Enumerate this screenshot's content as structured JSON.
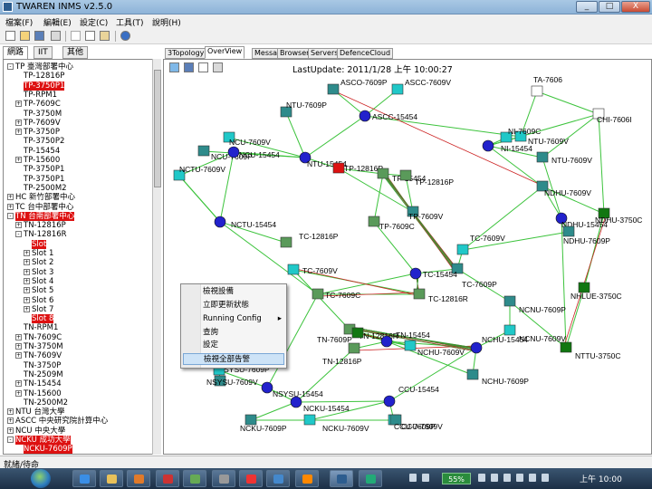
{
  "window": {
    "title": "TWAREN INMS v2.5.0",
    "min": "_",
    "max": "□",
    "close": "X"
  },
  "menu": [
    "檔案(F)",
    "編輯(E)",
    "設定(C)",
    "工具(T)",
    "說明(H)"
  ],
  "left_tabs": [
    "網路",
    "IIT",
    "其他"
  ],
  "tree": [
    {
      "label": "TP 臺灣部署中心",
      "depth": 0,
      "exp": "-",
      "hl": false
    },
    {
      "label": "TP-12816P",
      "depth": 1,
      "exp": "",
      "hl": false
    },
    {
      "label": "TP-3750P1",
      "depth": 1,
      "exp": "",
      "hl": true
    },
    {
      "label": "TP-RPM1",
      "depth": 1,
      "exp": "",
      "hl": false
    },
    {
      "label": "TP-7609C",
      "depth": 1,
      "exp": "+",
      "hl": false
    },
    {
      "label": "TP-3750M",
      "depth": 1,
      "exp": "",
      "hl": false
    },
    {
      "label": "TP-7609V",
      "depth": 1,
      "exp": "+",
      "hl": false
    },
    {
      "label": "TP-3750P",
      "depth": 1,
      "exp": "+",
      "hl": false
    },
    {
      "label": "TP-3750P2",
      "depth": 1,
      "exp": "",
      "hl": false
    },
    {
      "label": "TP-15454",
      "depth": 1,
      "exp": "",
      "hl": false
    },
    {
      "label": "TP-15600",
      "depth": 1,
      "exp": "+",
      "hl": false
    },
    {
      "label": "TP-3750P1",
      "depth": 1,
      "exp": "",
      "hl": false
    },
    {
      "label": "TP-3750P1",
      "depth": 1,
      "exp": "",
      "hl": false
    },
    {
      "label": "TP-2500M2",
      "depth": 1,
      "exp": "",
      "hl": false
    },
    {
      "label": "HC 新竹部署中心",
      "depth": 0,
      "exp": "+",
      "hl": false
    },
    {
      "label": "TC 台中部署中心",
      "depth": 0,
      "exp": "+",
      "hl": false
    },
    {
      "label": "TN 台南部署中心",
      "depth": 0,
      "exp": "-",
      "hl": true
    },
    {
      "label": "TN-12816P",
      "depth": 1,
      "exp": "+",
      "hl": false
    },
    {
      "label": "TN-12816R",
      "depth": 1,
      "exp": "-",
      "hl": false
    },
    {
      "label": "Slot",
      "depth": 2,
      "exp": "",
      "hl": true
    },
    {
      "label": "Slot 1",
      "depth": 2,
      "exp": "+",
      "hl": false
    },
    {
      "label": "Slot 2",
      "depth": 2,
      "exp": "+",
      "hl": false
    },
    {
      "label": "Slot 3",
      "depth": 2,
      "exp": "+",
      "hl": false
    },
    {
      "label": "Slot 4",
      "depth": 2,
      "exp": "+",
      "hl": false
    },
    {
      "label": "Slot 5",
      "depth": 2,
      "exp": "+",
      "hl": false
    },
    {
      "label": "Slot 6",
      "depth": 2,
      "exp": "+",
      "hl": false
    },
    {
      "label": "Slot 7",
      "depth": 2,
      "exp": "+",
      "hl": false
    },
    {
      "label": "Slot 8",
      "depth": 2,
      "exp": "",
      "hl": true
    },
    {
      "label": "TN-RPM1",
      "depth": 1,
      "exp": "",
      "hl": false
    },
    {
      "label": "TN-7609C",
      "depth": 1,
      "exp": "+",
      "hl": false
    },
    {
      "label": "TN-3750M",
      "depth": 1,
      "exp": "+",
      "hl": false
    },
    {
      "label": "TN-7609V",
      "depth": 1,
      "exp": "+",
      "hl": false
    },
    {
      "label": "TN-3750P",
      "depth": 1,
      "exp": "",
      "hl": false
    },
    {
      "label": "TN-2509M",
      "depth": 1,
      "exp": "",
      "hl": false
    },
    {
      "label": "TN-15454",
      "depth": 1,
      "exp": "+",
      "hl": false
    },
    {
      "label": "TN-15600",
      "depth": 1,
      "exp": "+",
      "hl": false
    },
    {
      "label": "TN-2500M2",
      "depth": 1,
      "exp": "",
      "hl": false
    },
    {
      "label": "NTU 台灣大學",
      "depth": 0,
      "exp": "+",
      "hl": false
    },
    {
      "label": "ASCC 中央研究院計算中心",
      "depth": 0,
      "exp": "+",
      "hl": false
    },
    {
      "label": "NCU 中央大學",
      "depth": 0,
      "exp": "+",
      "hl": false
    },
    {
      "label": "NCKU 成功大學",
      "depth": 0,
      "exp": "-",
      "hl": true
    },
    {
      "label": "NCKU-7609P",
      "depth": 1,
      "exp": "",
      "hl": true
    }
  ],
  "main_tabs": [
    "3Topology",
    "OverView",
    "Messages",
    "Browser",
    "Servers",
    "DefenceCloud"
  ],
  "last_update": "LastUpdate: 2011/1/28 上午 10:00:27",
  "context_menu": [
    {
      "label": "檢視設備",
      "sel": false,
      "sub": false
    },
    {
      "label": "立即更新狀態",
      "sel": false,
      "sub": false
    },
    {
      "label": "Running Config",
      "sel": false,
      "sub": true
    },
    {
      "label": "查詢",
      "sel": false,
      "sub": false
    },
    {
      "label": "設定",
      "sel": false,
      "sub": false
    },
    {
      "label": "檢視全部告警",
      "sel": true,
      "sub": false
    }
  ],
  "nodes": [
    {
      "label": "ASCO-7609P",
      "shape": "sq",
      "color": "#2e8b8b"
    },
    {
      "label": "ASCC-7609V",
      "shape": "sq",
      "color": "#20c8c8"
    },
    {
      "label": "TA-7606",
      "shape": "sq",
      "color": "#ffffff"
    },
    {
      "label": "CHI-7606I",
      "shape": "sq",
      "color": "#ffffff"
    },
    {
      "label": "NTU-7609P",
      "shape": "sq",
      "color": "#2e8b8b"
    },
    {
      "label": "ASCC-15454",
      "shape": "ci",
      "color": "#2222cc"
    },
    {
      "label": "NTU-7609V",
      "shape": "sq",
      "color": "#20c8c8"
    },
    {
      "label": "NCU-7609V",
      "shape": "sq",
      "color": "#20c8c8"
    },
    {
      "label": "NCU-7609P",
      "shape": "sq",
      "color": "#2e8b8b"
    },
    {
      "label": "NTU-15454",
      "shape": "ci",
      "color": "#2222cc"
    },
    {
      "label": "NI-7609C",
      "shape": "sq",
      "color": "#20c8c8"
    },
    {
      "label": "NI-15454",
      "shape": "ci",
      "color": "#2222cc"
    },
    {
      "label": "NCU-15454",
      "shape": "ci",
      "color": "#2222cc"
    },
    {
      "label": "NTU-7609V",
      "shape": "sq",
      "color": "#2e8b8b"
    },
    {
      "label": "NCTU-7609V",
      "shape": "sq",
      "color": "#20c8c8"
    },
    {
      "label": "TP-12816P",
      "shape": "sq",
      "color": "#dd1111"
    },
    {
      "label": "TP-15454",
      "shape": "sq",
      "color": "#5a9a5a"
    },
    {
      "label": "TP-12816P",
      "shape": "sq",
      "color": "#5a9a5a"
    },
    {
      "label": "NDHU-7609V",
      "shape": "sq",
      "color": "#2e8b8b"
    },
    {
      "label": "NDHU-3750C",
      "shape": "sq",
      "color": "#117711"
    },
    {
      "label": "NCTU-15454",
      "shape": "ci",
      "color": "#2222cc"
    },
    {
      "label": "TP-7609V",
      "shape": "sq",
      "color": "#2e8b8b"
    },
    {
      "label": "TP-7609C",
      "shape": "sq",
      "color": "#5a9a5a"
    },
    {
      "label": "NDHU-15454",
      "shape": "ci",
      "color": "#2222cc"
    },
    {
      "label": "NDHU-7609P",
      "shape": "sq",
      "color": "#2e8b8b"
    },
    {
      "label": "TC-12816P",
      "shape": "sq",
      "color": "#5a9a5a"
    },
    {
      "label": "TC-7609V",
      "shape": "sq",
      "color": "#20c8c8"
    },
    {
      "label": "TC-7609P",
      "shape": "sq",
      "color": "#2e8b8b"
    },
    {
      "label": "TC-15454",
      "shape": "ci",
      "color": "#2222cc"
    },
    {
      "label": "TC-7609C",
      "shape": "sq",
      "color": "#5a9a5a"
    },
    {
      "label": "TC-12816R",
      "shape": "sq",
      "color": "#5a9a5a"
    },
    {
      "label": "TC-7609V",
      "shape": "sq",
      "color": "#20c8c8"
    },
    {
      "label": "NCNU-7609P",
      "shape": "sq",
      "color": "#2e8b8b"
    },
    {
      "label": "NHLUE-3750C",
      "shape": "sq",
      "color": "#117711"
    },
    {
      "label": "NCNU-7609V",
      "shape": "sq",
      "color": "#20c8c8"
    },
    {
      "label": "TN-12816R",
      "shape": "sq",
      "color": "#5a9a5a"
    },
    {
      "label": "TN-15454",
      "shape": "ci",
      "color": "#2222cc"
    },
    {
      "label": "TN-7609P",
      "shape": "sq",
      "color": "#117711"
    },
    {
      "label": "NCHU-15454",
      "shape": "ci",
      "color": "#2222cc"
    },
    {
      "label": "NCHU-7609P",
      "shape": "sq",
      "color": "#2e8b8b"
    },
    {
      "label": "NTTU-3750C",
      "shape": "sq",
      "color": "#117711"
    },
    {
      "label": "TN-12816P",
      "shape": "sq",
      "color": "#5a9a5a"
    },
    {
      "label": "NCHU-7609V",
      "shape": "sq",
      "color": "#20c8c8"
    },
    {
      "label": "NSYSU-7609P",
      "shape": "sq",
      "color": "#2e8b8b"
    },
    {
      "label": "NSYSU-15454",
      "shape": "ci",
      "color": "#2222cc"
    },
    {
      "label": "NSYSU-7609V",
      "shape": "sq",
      "color": "#20c8c8"
    },
    {
      "label": "NCKU-15454",
      "shape": "ci",
      "color": "#2222cc"
    },
    {
      "label": "CCU-15454",
      "shape": "ci",
      "color": "#2222cc"
    },
    {
      "label": "CCU-7609V",
      "shape": "sq",
      "color": "#20c8c8"
    },
    {
      "label": "NCKU-7609P",
      "shape": "sq",
      "color": "#2e8b8b"
    },
    {
      "label": "NCKU-7609V",
      "shape": "sq",
      "color": "#20c8c8"
    },
    {
      "label": "CCU-7609P",
      "shape": "sq",
      "color": "#2e8b8b"
    }
  ],
  "status": "就緒/待命",
  "taskbar": {
    "battery": "55%",
    "clock": "上午 10:00"
  }
}
